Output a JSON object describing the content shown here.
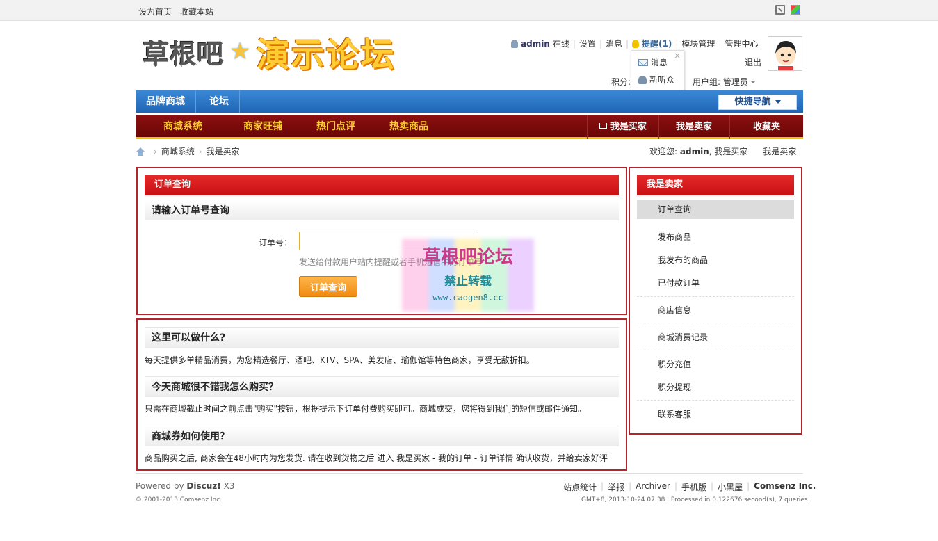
{
  "topbar": {
    "set_home": "设为首页",
    "bookmark": "收藏本站"
  },
  "logo": {
    "part1": "草根吧",
    "part2": "演示论坛"
  },
  "userbar": {
    "username": "admin",
    "online": "在线",
    "settings": "设置",
    "messages": "消息",
    "notice": "提醒(1)",
    "block_manage": "模块管理",
    "admin_center": "管理中心",
    "logout": "退出",
    "credit_label": "积分:",
    "group_label": "用户组: 管理员"
  },
  "popup": {
    "close": "×",
    "item1": "消息",
    "item2": "新听众"
  },
  "nav_blue": {
    "items": [
      "品牌商城",
      "论坛"
    ],
    "quick_nav": "快捷导航"
  },
  "nav_red": {
    "items": [
      "商城系统",
      "商家旺铺",
      "热门点评",
      "热卖商品"
    ],
    "right": [
      "我是买家",
      "我是卖家",
      "收藏夹"
    ]
  },
  "breadcrumb": {
    "items": [
      "商城系统",
      "我是卖家"
    ],
    "welcome_prefix": "欢迎您:",
    "welcome_user": "admin",
    "welcome_role": ", 我是买家",
    "seller_link": "我是卖家"
  },
  "order_box": {
    "title": "订单查询",
    "subtitle": "请输入订单号查询",
    "label": "订单号：",
    "input_value": "",
    "input_placeholder": "",
    "hint": "发送给付款用户站内提醒或者手机短信中的订单号",
    "button": "订单查询"
  },
  "faq": [
    {
      "q": "这里可以做什么?",
      "a": "每天提供多单精品消费，为您精选餐厅、酒吧、KTV、SPA、美发店、瑜伽馆等特色商家，享受无敌折扣。"
    },
    {
      "q": "今天商城很不错我怎么购买？",
      "a": "只需在商城截止时间之前点击\"购买\"按钮，根据提示下订单付费购买即可。商城成交，您将得到我们的短信或邮件通知。"
    },
    {
      "q": "商城券如何使用？",
      "a": "商品购买之后, 商家会在48小时内为您发货. 请在收到货物之后 进入 我是买家 - 我的订单 - 订单详情 确认收货，并给卖家好评"
    }
  ],
  "sidebar": {
    "title": "我是卖家",
    "items": [
      "订单查询",
      "发布商品",
      "我发布的商品",
      "已付款订单",
      "商店信息",
      "商城消费记录",
      "积分充值",
      "积分提现",
      "联系客服"
    ]
  },
  "watermark": {
    "t1": "草根吧论坛",
    "t2": "禁止转载",
    "t3": "www.caogen8.cc"
  },
  "footer": {
    "powered_prefix": "Powered by",
    "powered_brand": "Discuz!",
    "powered_ver": "X3",
    "copyright": "© 2001-2013 Comsenz Inc.",
    "links": [
      "站点统计",
      "举报",
      "Archiver",
      "手机版",
      "小黑屋"
    ],
    "company": "Comsenz Inc.",
    "debug": "GMT+8, 2013-10-24 07:38 , Processed in 0.122676 second(s), 7 queries ."
  },
  "colors": {
    "nav_blue": "#2a77c8",
    "nav_red": "#7a0a0a",
    "accent_red": "#b5232c",
    "button_orange": "#f5a030"
  }
}
